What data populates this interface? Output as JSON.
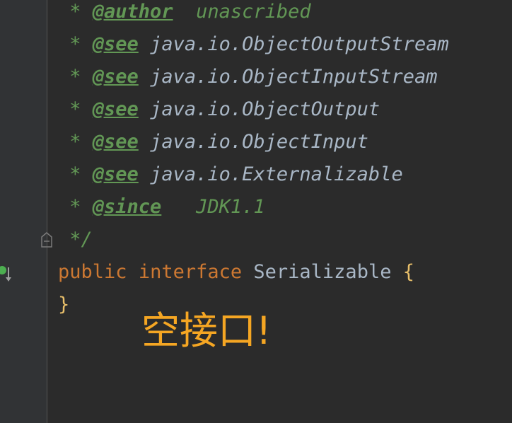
{
  "doc_comment": {
    "lines": [
      {
        "star": " * ",
        "tag": "@author",
        "sep": "  ",
        "text": "unascribed",
        "text_kind": "doc"
      },
      {
        "star": " * ",
        "tag": "@see",
        "sep": " ",
        "text": "java.io.ObjectOutputStream",
        "text_kind": "ref"
      },
      {
        "star": " * ",
        "tag": "@see",
        "sep": " ",
        "text": "java.io.ObjectInputStream",
        "text_kind": "ref"
      },
      {
        "star": " * ",
        "tag": "@see",
        "sep": " ",
        "text": "java.io.ObjectOutput",
        "text_kind": "ref"
      },
      {
        "star": " * ",
        "tag": "@see",
        "sep": " ",
        "text": "java.io.ObjectInput",
        "text_kind": "ref"
      },
      {
        "star": " * ",
        "tag": "@see",
        "sep": " ",
        "text": "java.io.Externalizable",
        "text_kind": "ref"
      },
      {
        "star": " * ",
        "tag": "@since",
        "sep": "   ",
        "text": "JDK1.1",
        "text_kind": "doc"
      }
    ],
    "end": " */"
  },
  "declaration": {
    "modifier": "public",
    "keyword": "interface",
    "name": "Serializable",
    "open_brace": "{",
    "close_brace": "}"
  },
  "annotation": {
    "text": "空接口!",
    "color": "#f5a623"
  },
  "gutter": {
    "fold_icon": "fold-collapse-icon",
    "implementations_icon": "implemented-by-icon"
  },
  "colors": {
    "background": "#2b2b2b",
    "doc_comment": "#629755",
    "keyword": "#cc7832",
    "identifier": "#a9b7c6",
    "brace": "#e8bf6a"
  }
}
